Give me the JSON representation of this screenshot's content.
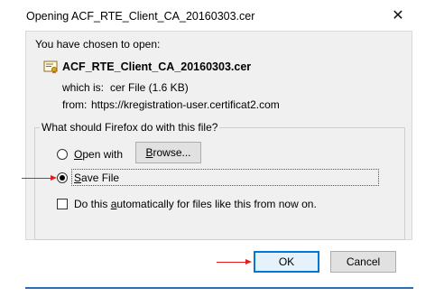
{
  "dialog": {
    "title": "Opening ACF_RTE_Client_CA_20160303.cer",
    "close_glyph": "✕"
  },
  "info": {
    "heading": "You have chosen to open:",
    "file_name": "ACF_RTE_Client_CA_20160303.cer",
    "which_is_label": "which is:",
    "which_is_value": "cer File (1.6 KB)",
    "from_label": "from:",
    "from_value": "https://kregistration-user.certificat2.com"
  },
  "choice": {
    "group_label": "What should Firefox do with this file?",
    "open_with_prefix": "O",
    "open_with_rest": "pen with",
    "browse_prefix": "B",
    "browse_rest": "rowse...",
    "save_file_prefix": "S",
    "save_file_rest": "ave File",
    "auto_pre": "Do this ",
    "auto_underlined": "a",
    "auto_post": "utomatically for files like this from now on."
  },
  "buttons": {
    "ok": "OK",
    "cancel": "Cancel"
  },
  "colors": {
    "accent": "#0078d7",
    "annotation": "#e02020"
  },
  "state": {
    "selected_option": "Save File",
    "auto_checked": false
  }
}
